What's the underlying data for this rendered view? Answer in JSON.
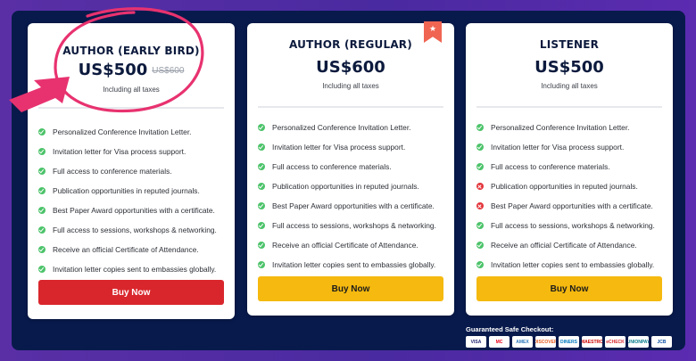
{
  "cards": [
    {
      "title": "AUTHOR (EARLY BIRD)",
      "price": "US$500",
      "old_price": "US$600",
      "tax_note": "Including all taxes",
      "button": "Buy Now",
      "features": [
        {
          "text": "Personalized Conference Invitation Letter.",
          "included": true
        },
        {
          "text": "Invitation letter for Visa process support.",
          "included": true
        },
        {
          "text": "Full access to conference materials.",
          "included": true
        },
        {
          "text": "Publication opportunities in reputed journals.",
          "included": true
        },
        {
          "text": "Best Paper Award opportunities with a certificate.",
          "included": true
        },
        {
          "text": "Full access to sessions, workshops & networking.",
          "included": true
        },
        {
          "text": "Receive an official Certificate of Attendance.",
          "included": true
        },
        {
          "text": "Invitation letter copies sent to embassies globally.",
          "included": true
        }
      ]
    },
    {
      "title": "AUTHOR (REGULAR)",
      "price": "US$600",
      "tax_note": "Including all taxes",
      "button": "Buy Now",
      "features": [
        {
          "text": "Personalized Conference Invitation Letter.",
          "included": true
        },
        {
          "text": "Invitation letter for Visa process support.",
          "included": true
        },
        {
          "text": "Full access to conference materials.",
          "included": true
        },
        {
          "text": "Publication opportunities in reputed journals.",
          "included": true
        },
        {
          "text": "Best Paper Award opportunities with a certificate.",
          "included": true
        },
        {
          "text": "Full access to sessions, workshops & networking.",
          "included": true
        },
        {
          "text": "Receive an official Certificate of Attendance.",
          "included": true
        },
        {
          "text": "Invitation letter copies sent to embassies globally.",
          "included": true
        }
      ]
    },
    {
      "title": "LISTENER",
      "price": "US$500",
      "tax_note": "Including all taxes",
      "button": "Buy Now",
      "features": [
        {
          "text": "Personalized Conference Invitation Letter.",
          "included": true
        },
        {
          "text": "Invitation letter for Visa process support.",
          "included": true
        },
        {
          "text": "Full access to conference materials.",
          "included": true
        },
        {
          "text": "Publication opportunities in reputed journals.",
          "included": false
        },
        {
          "text": "Best Paper Award opportunities with a certificate.",
          "included": false
        },
        {
          "text": "Full access to sessions, workshops & networking.",
          "included": true
        },
        {
          "text": "Receive an official Certificate of Attendance.",
          "included": true
        },
        {
          "text": "Invitation letter copies sent to embassies globally.",
          "included": true
        }
      ]
    }
  ],
  "checkout": {
    "title": "Guaranteed Safe Checkout:",
    "methods": [
      "VISA",
      "MC",
      "AMEX",
      "DISCOVER",
      "DINERS",
      "MAESTRO",
      "eCHECK",
      "UNIONPAY",
      "JCB"
    ]
  },
  "colors": {
    "background": "#081a4c",
    "early_bird_button": "#d9262c",
    "regular_button": "#f5b90f",
    "annotation": "#e8326f",
    "ribbon": "#f06552",
    "check": "#4cc36a",
    "cross": "#e3343a"
  },
  "icons": {
    "featured": "ribbon-star-icon",
    "included": "check-circle-icon",
    "excluded": "cross-circle-icon",
    "annotation": "arrow-icon"
  }
}
